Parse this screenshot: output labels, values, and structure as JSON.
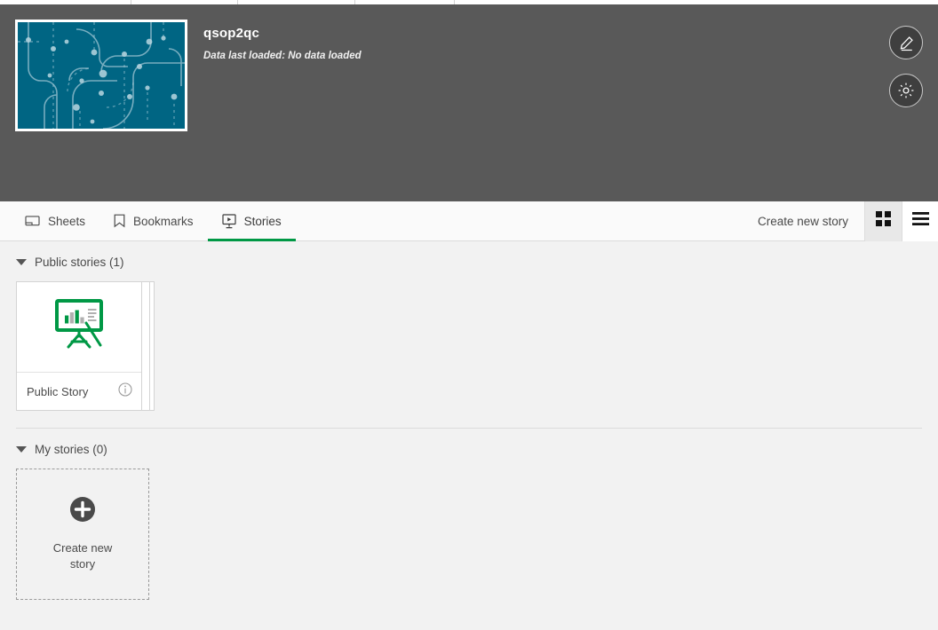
{
  "colors": {
    "header_bg": "#595959",
    "thumb_teal": "#006583",
    "accent_green": "#009845",
    "content_bg": "#f2f2f2",
    "toolbar_bg": "#fafafa",
    "text_grey": "#4a4a4a"
  },
  "app": {
    "title": "qsop2qc",
    "subtitle": "Data last loaded: No data loaded",
    "thumbnail_icon": "app-thumbnail-image",
    "edit_icon": "pencil-icon",
    "settings_icon": "gear-icon"
  },
  "toolbar": {
    "tabs": [
      {
        "label": "Sheets",
        "icon": "sheet-icon",
        "active": false
      },
      {
        "label": "Bookmarks",
        "icon": "bookmark-icon",
        "active": false
      },
      {
        "label": "Stories",
        "icon": "story-icon",
        "active": true
      }
    ],
    "create_link": "Create new story",
    "view_toggles": [
      {
        "icon": "grid-view-icon",
        "active": true
      },
      {
        "icon": "list-view-icon",
        "active": false
      }
    ]
  },
  "sections": {
    "public": {
      "title": "Public stories (1)",
      "caret_icon": "caret-down-icon",
      "story": {
        "name": "Public Story",
        "thumb_icon": "story-easel-icon",
        "info_icon": "info-circle-icon"
      }
    },
    "mine": {
      "title": "My stories (0)",
      "caret_icon": "caret-down-icon",
      "create_card": {
        "label": "Create new story",
        "icon": "plus-circle-icon"
      }
    }
  }
}
